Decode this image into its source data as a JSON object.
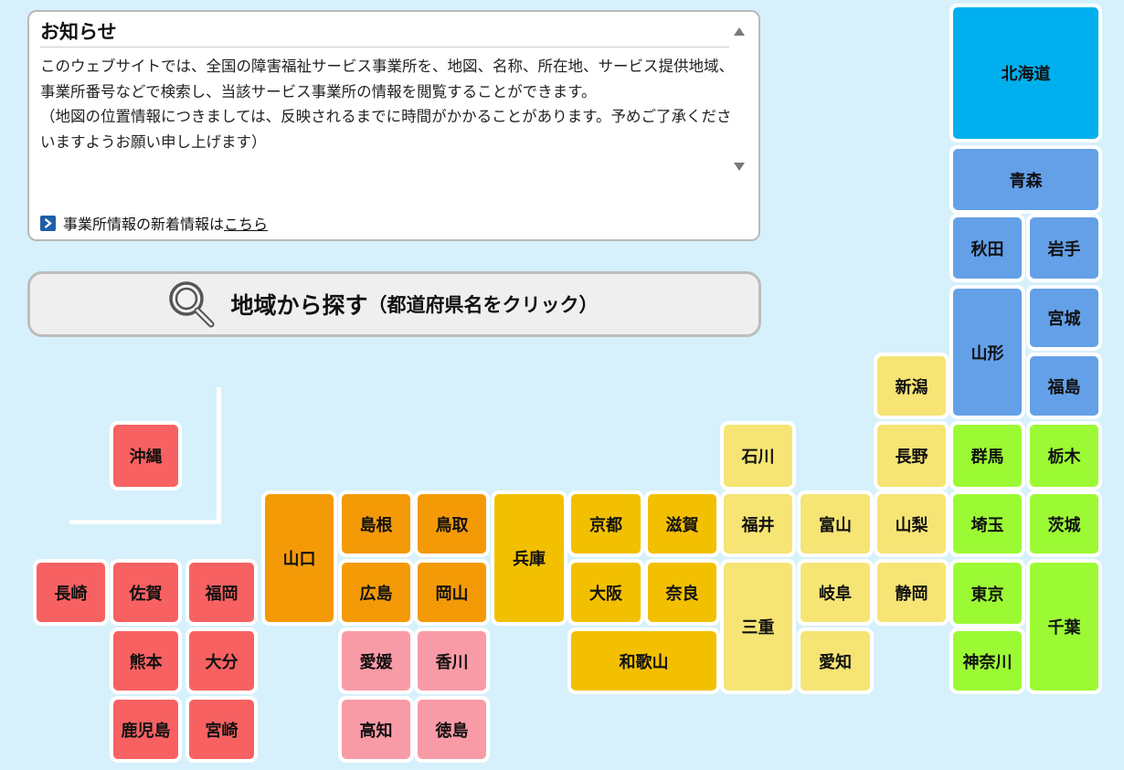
{
  "notice": {
    "title": "お知らせ",
    "body_1": "このウェブサイトでは、全国の障害福祉サービス事業所を、地図、名称、所在地、サービス提供地域、事業所番号などで検索し、当該サービス事業所の情報を閲覧することができます。",
    "body_2": "（地図の位置情報につきましては、反映されるまでに時間がかかることがあります。予めご了承くださいますようお願い申し上げます）",
    "news_prefix": "事業所情報の新着情報は",
    "news_link": "こちら"
  },
  "search": {
    "label": "地域から探す",
    "sub": "（都道府県名をクリック）"
  },
  "colors": {
    "background": "#d6f1fc",
    "hokkaido": "#00b0ee",
    "tohoku": "#63a0e8",
    "kanto": "#9cfa34",
    "chubu": "#f6e474",
    "kinki": "#f2c000",
    "chugoku": "#f39a06",
    "shikoku": "#f99ba7",
    "kyushu": "#f86162"
  },
  "prefectures": [
    {
      "id": "hokkaido",
      "name": "北海道",
      "region": "hokkaido"
    },
    {
      "id": "aomori",
      "name": "青森",
      "region": "tohoku"
    },
    {
      "id": "akita",
      "name": "秋田",
      "region": "tohoku"
    },
    {
      "id": "iwate",
      "name": "岩手",
      "region": "tohoku"
    },
    {
      "id": "yamagata",
      "name": "山形",
      "region": "tohoku"
    },
    {
      "id": "miyagi",
      "name": "宮城",
      "region": "tohoku"
    },
    {
      "id": "fukushima",
      "name": "福島",
      "region": "tohoku"
    },
    {
      "id": "niigata",
      "name": "新潟",
      "region": "chubu"
    },
    {
      "id": "ishikawa",
      "name": "石川",
      "region": "chubu"
    },
    {
      "id": "nagano",
      "name": "長野",
      "region": "chubu"
    },
    {
      "id": "gunma",
      "name": "群馬",
      "region": "kanto"
    },
    {
      "id": "tochigi",
      "name": "栃木",
      "region": "kanto"
    },
    {
      "id": "okinawa",
      "name": "沖縄",
      "region": "kyushu"
    },
    {
      "id": "yamaguchi",
      "name": "山口",
      "region": "chugoku"
    },
    {
      "id": "shimane",
      "name": "島根",
      "region": "chugoku"
    },
    {
      "id": "tottori",
      "name": "鳥取",
      "region": "chugoku"
    },
    {
      "id": "hyogo",
      "name": "兵庫",
      "region": "kinki"
    },
    {
      "id": "kyoto",
      "name": "京都",
      "region": "kinki"
    },
    {
      "id": "shiga",
      "name": "滋賀",
      "region": "kinki"
    },
    {
      "id": "fukui",
      "name": "福井",
      "region": "chubu"
    },
    {
      "id": "toyama",
      "name": "富山",
      "region": "chubu"
    },
    {
      "id": "yamanashi",
      "name": "山梨",
      "region": "chubu"
    },
    {
      "id": "saitama",
      "name": "埼玉",
      "region": "kanto"
    },
    {
      "id": "ibaraki",
      "name": "茨城",
      "region": "kanto"
    },
    {
      "id": "nagasaki",
      "name": "長崎",
      "region": "kyushu"
    },
    {
      "id": "saga",
      "name": "佐賀",
      "region": "kyushu"
    },
    {
      "id": "fukuoka",
      "name": "福岡",
      "region": "kyushu"
    },
    {
      "id": "hiroshima",
      "name": "広島",
      "region": "chugoku"
    },
    {
      "id": "okayama",
      "name": "岡山",
      "region": "chugoku"
    },
    {
      "id": "osaka",
      "name": "大阪",
      "region": "kinki"
    },
    {
      "id": "nara",
      "name": "奈良",
      "region": "kinki"
    },
    {
      "id": "mie",
      "name": "三重",
      "region": "chubu"
    },
    {
      "id": "gifu",
      "name": "岐阜",
      "region": "chubu"
    },
    {
      "id": "shizuoka",
      "name": "静岡",
      "region": "chubu"
    },
    {
      "id": "tokyo",
      "name": "東京",
      "region": "kanto"
    },
    {
      "id": "chiba",
      "name": "千葉",
      "region": "kanto"
    },
    {
      "id": "kumamoto",
      "name": "熊本",
      "region": "kyushu"
    },
    {
      "id": "oita",
      "name": "大分",
      "region": "kyushu"
    },
    {
      "id": "ehime",
      "name": "愛媛",
      "region": "shikoku"
    },
    {
      "id": "kagawa",
      "name": "香川",
      "region": "shikoku"
    },
    {
      "id": "wakayama",
      "name": "和歌山",
      "region": "kinki"
    },
    {
      "id": "aichi",
      "name": "愛知",
      "region": "chubu"
    },
    {
      "id": "kanagawa",
      "name": "神奈川",
      "region": "kanto"
    },
    {
      "id": "kagoshima",
      "name": "鹿児島",
      "region": "kyushu"
    },
    {
      "id": "miyazaki",
      "name": "宮崎",
      "region": "kyushu"
    },
    {
      "id": "kochi",
      "name": "高知",
      "region": "shikoku"
    },
    {
      "id": "tokushima",
      "name": "徳島",
      "region": "shikoku"
    }
  ]
}
